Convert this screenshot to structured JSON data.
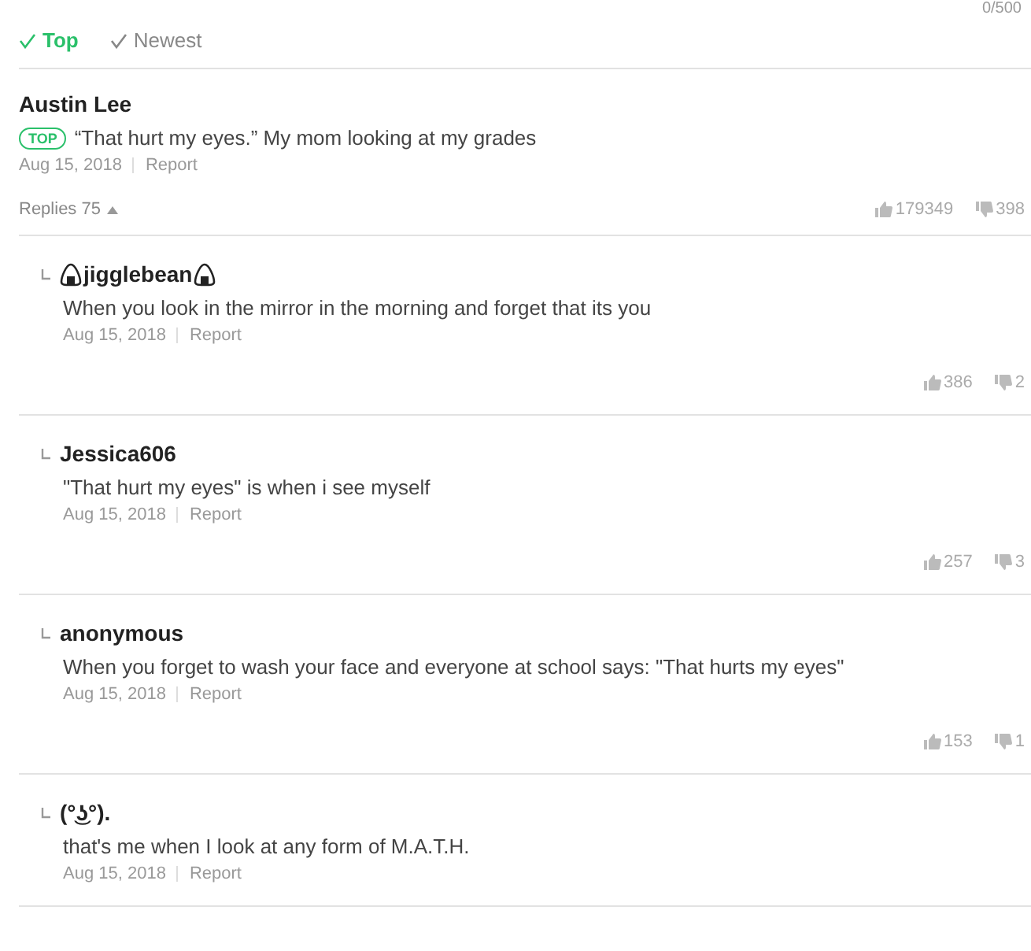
{
  "counter": "0/500",
  "sort_tabs": [
    {
      "label": "Top",
      "selected": true
    },
    {
      "label": "Newest",
      "selected": false
    }
  ],
  "comment": {
    "author": "Austin Lee",
    "badge": "TOP",
    "text": "“That hurt my eyes.” My mom looking at my grades",
    "date": "Aug 15, 2018",
    "report": "Report",
    "replies_label": "Replies 75",
    "replies_expanded": true,
    "likes": "179349",
    "dislikes": "398"
  },
  "replies": [
    {
      "author": "jigglebean",
      "author_icons": true,
      "text": "When you look in the mirror in the morning and forget that its you",
      "date": "Aug 15, 2018",
      "report": "Report",
      "likes": "386",
      "dislikes": "2"
    },
    {
      "author": "Jessica606",
      "author_icons": false,
      "text": "\"That hurt my eyes\" is when i see myself",
      "date": "Aug 15, 2018",
      "report": "Report",
      "likes": "257",
      "dislikes": "3"
    },
    {
      "author": "anonymous",
      "author_icons": false,
      "text": "When you forget to wash your face and everyone at school says: \"That hurts my eyes\"",
      "date": "Aug 15, 2018",
      "report": "Report",
      "likes": "153",
      "dislikes": "1"
    },
    {
      "author": "(°͜ʖ°).",
      "author_icons": false,
      "text": "that's me when I look at any form of M.A.T.H.",
      "date": "Aug 15, 2018",
      "report": "Report"
    }
  ]
}
